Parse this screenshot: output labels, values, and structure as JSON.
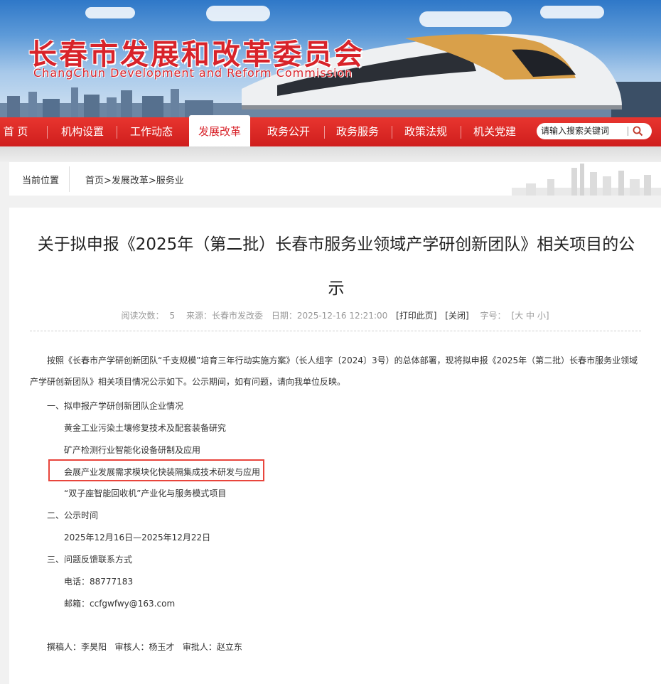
{
  "header": {
    "title_cn": "长春市发展和改革委员会",
    "title_en": "ChangChun Development and Reform Commission"
  },
  "nav": {
    "items": [
      {
        "label": "首  页"
      },
      {
        "label": "机构设置"
      },
      {
        "label": "工作动态"
      },
      {
        "label": "发展改革"
      },
      {
        "label": "政务公开"
      },
      {
        "label": "政务服务"
      },
      {
        "label": "政策法规"
      },
      {
        "label": "机关党建"
      }
    ],
    "active_label": "发展改革"
  },
  "search": {
    "placeholder": "请输入搜索关键词"
  },
  "breadcrumb": {
    "label": "当前位置",
    "path": "首页>发展改革>服务业"
  },
  "article": {
    "title": "关于拟申报《2025年（第二批）长春市服务业领域产学研创新团队》相关项目的公示",
    "meta": {
      "reads_label": "阅读次数：",
      "reads": "5",
      "source": "来源：长春市发改委",
      "date": "日期：2025-12-16 12:21:00",
      "print": "[打印此页]",
      "close": "[关闭]",
      "font_label": "字号：",
      "font_sizes": "[大 中 小]"
    },
    "intro": "按照《长春市产学研创新团队“千支规模”培育三年行动实施方案》（长人组字〔2024〕3号）的总体部署，现将拟申报《2025年（第二批）长春市服务业领域产学研创新团队》相关项目情况公示如下。公示期间，如有问题，请向我单位反映。",
    "section1": "一、拟申报产学研创新团队企业情况",
    "projects": [
      "黄金工业污染土壤修复技术及配套装备研究",
      "矿产检测行业智能化设备研制及应用",
      "会展产业发展需求模块化快装隔集成技术研发与应用",
      "“双子座智能回收机”产业化与服务模式项目"
    ],
    "section2": "二、公示时间",
    "period": "2025年12月16日—2025年12月22日",
    "section3": "三、问题反馈联系方式",
    "phone": "电话：88777183",
    "email": "邮箱：ccfgwfwy@163.com",
    "signoff": "撰稿人：李昊阳   审核人：杨玉才   审批人：赵立东"
  },
  "colors": {
    "brand_red": "#d8232a",
    "highlight_box": "#e8453c"
  }
}
